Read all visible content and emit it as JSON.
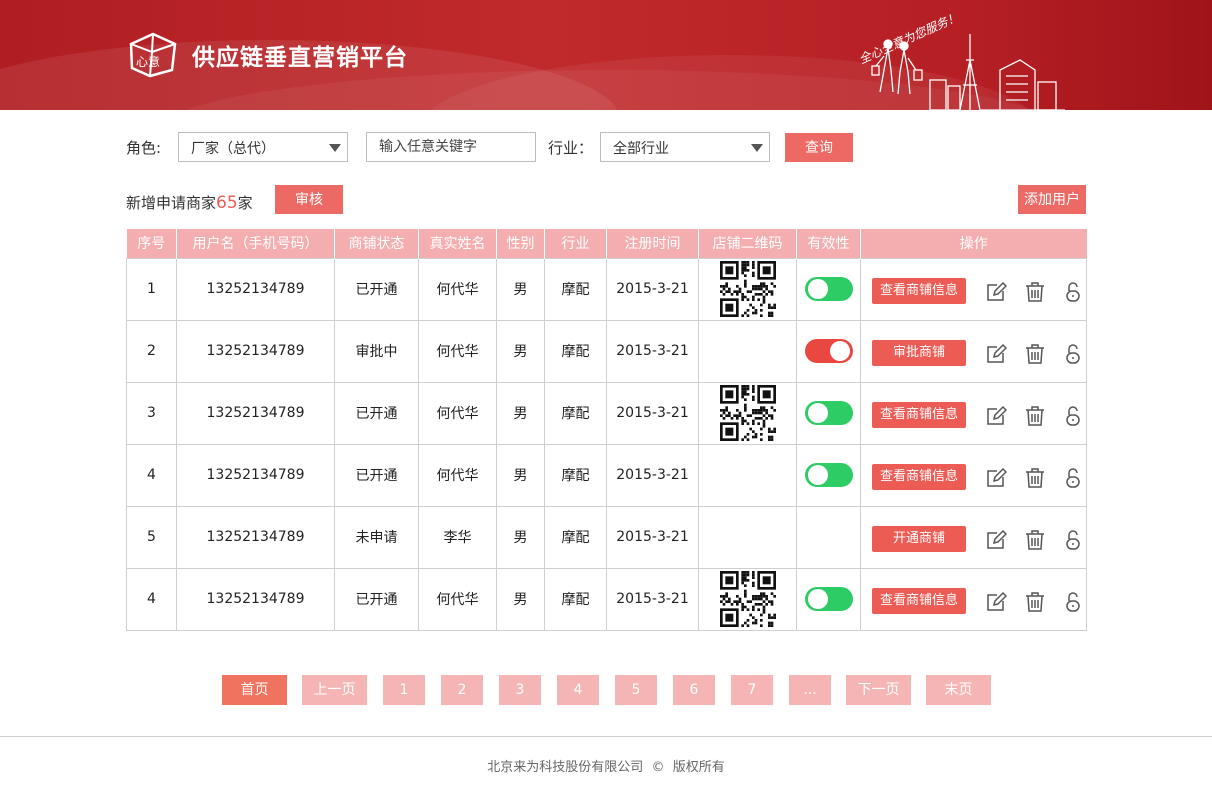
{
  "header": {
    "title": "供应链垂直营销平台",
    "logo_text": "心意",
    "slogan": "全心全意为您服务！"
  },
  "filters": {
    "role_label": "角色:",
    "role_value": "厂家（总代）",
    "keyword_placeholder": "输入任意关键字",
    "industry_label": "行业：",
    "industry_value": "全部行业",
    "search_label": "查询"
  },
  "info": {
    "prefix": "新增申请商家",
    "count": "65",
    "suffix": "家",
    "review_label": "审核",
    "add_user_label": "添加用户"
  },
  "table": {
    "headers": [
      "序号",
      "用户名（手机号码）",
      "商铺状态",
      "真实姓名",
      "性别",
      "行业",
      "注册时间",
      "店铺二维码",
      "有效性",
      "操作"
    ],
    "rows": [
      {
        "no": "1",
        "phone": "13252134789",
        "status": "已开通",
        "name": "何代华",
        "gender": "男",
        "industry": "摩配",
        "date": "2015-3-21",
        "qr": true,
        "valid": "on",
        "action": "查看商铺信息"
      },
      {
        "no": "2",
        "phone": "13252134789",
        "status": "审批中",
        "name": "何代华",
        "gender": "男",
        "industry": "摩配",
        "date": "2015-3-21",
        "qr": false,
        "valid": "off",
        "action": "审批商铺"
      },
      {
        "no": "3",
        "phone": "13252134789",
        "status": "已开通",
        "name": "何代华",
        "gender": "男",
        "industry": "摩配",
        "date": "2015-3-21",
        "qr": true,
        "valid": "on",
        "action": "查看商铺信息"
      },
      {
        "no": "4",
        "phone": "13252134789",
        "status": "已开通",
        "name": "何代华",
        "gender": "男",
        "industry": "摩配",
        "date": "2015-3-21",
        "qr": false,
        "valid": "on",
        "action": "查看商铺信息"
      },
      {
        "no": "5",
        "phone": "13252134789",
        "status": "未申请",
        "name": "李华",
        "gender": "男",
        "industry": "摩配",
        "date": "2015-3-21",
        "qr": false,
        "valid": "none",
        "action": "开通商铺"
      },
      {
        "no": "4",
        "phone": "13252134789",
        "status": "已开通",
        "name": "何代华",
        "gender": "男",
        "industry": "摩配",
        "date": "2015-3-21",
        "qr": true,
        "valid": "on",
        "action": "查看商铺信息"
      }
    ],
    "icons": {
      "edit": "edit-icon",
      "delete": "trash-icon",
      "lock": "unlock-icon"
    }
  },
  "pagination": {
    "first": "首页",
    "prev": "上一页",
    "pages": [
      "1",
      "2",
      "3",
      "4",
      "5",
      "6",
      "7",
      "..."
    ],
    "next": "下一页",
    "last": "末页",
    "active": "首页"
  },
  "colors": {
    "brand": "#b51f24",
    "accent": "#ed5b55",
    "header_bg": "#f5aeb0",
    "toggle_on": "#2ecc64",
    "toggle_off": "#e8483f"
  },
  "footer": {
    "company": "北京来为科技股份有限公司",
    "copyright_symbol": "©",
    "rights": "版权所有"
  }
}
